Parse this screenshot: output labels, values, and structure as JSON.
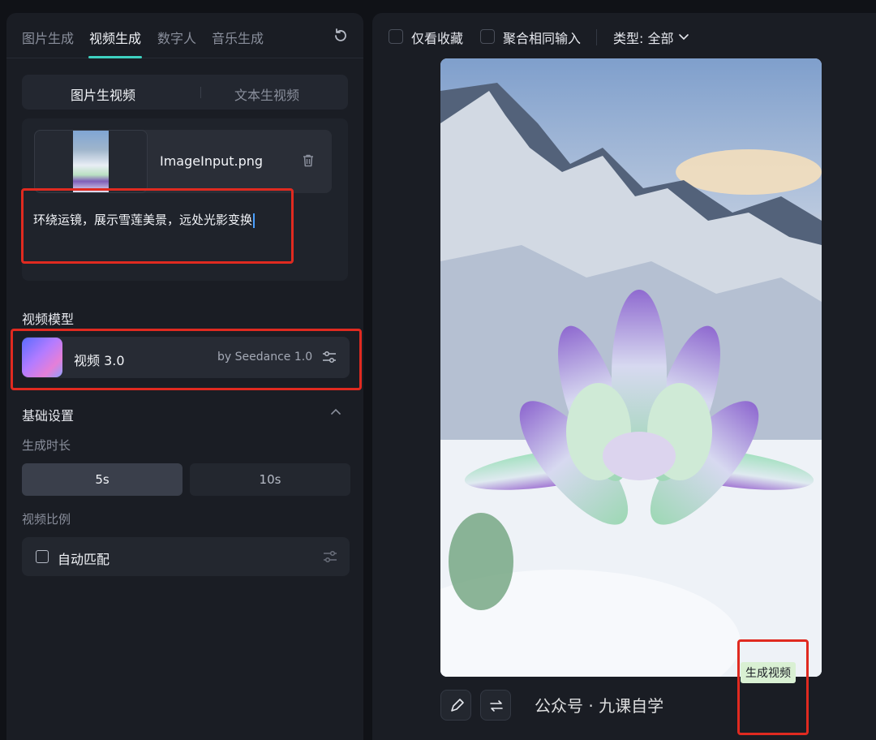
{
  "tabs": [
    "图片生成",
    "视频生成",
    "数字人",
    "音乐生成"
  ],
  "mode_tabs": [
    "图片生视频",
    "文本生视频"
  ],
  "file": {
    "name": "ImageInput.png"
  },
  "prompt": "环绕运镜，展示雪莲美景，远处光影变换",
  "model_section": {
    "title": "视频模型",
    "name": "视频 3.0",
    "by": "by Seedance 1.0"
  },
  "basic_settings": {
    "title": "基础设置",
    "duration_label": "生成时长",
    "durations": [
      "5s",
      "10s"
    ],
    "ratio_label": "视频比例",
    "ratio_value": "自动匹配"
  },
  "filters": {
    "favorites": "仅看收藏",
    "merge": "聚合相同输入",
    "type": "类型: 全部"
  },
  "tooltip": "生成视频",
  "watermark": "公众号 · 九课自学"
}
